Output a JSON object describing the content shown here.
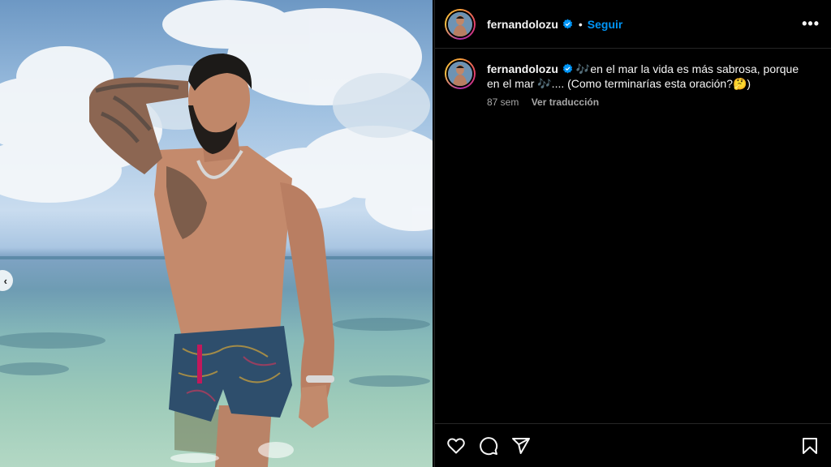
{
  "post": {
    "username": "fernandolozu",
    "follow_label": "Seguir",
    "separator": "•",
    "more_label": "•••",
    "caption_user": "fernandolozu",
    "caption_text": "🎶en el mar la vida es más sabrosa, porque en el mar 🎶.... (Como terminarías esta oración?🤔)",
    "time_ago": "87 sem",
    "translate_label": "Ver traducción"
  },
  "carousel": {
    "prev_label": "‹"
  },
  "icons": {
    "like": "heart-icon",
    "comment": "comment-icon",
    "share": "share-icon",
    "save": "bookmark-icon",
    "verified": "verified-badge-icon"
  },
  "colors": {
    "background": "#000000",
    "accent": "#0095f6",
    "text": "#f5f5f5",
    "muted": "#a8a8a8"
  }
}
